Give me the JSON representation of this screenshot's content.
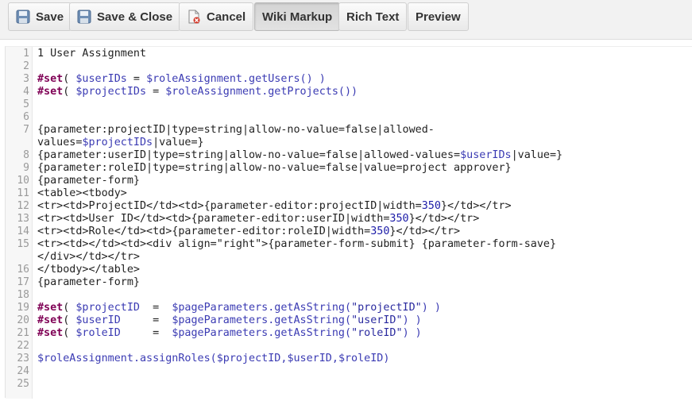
{
  "toolbar": {
    "save_label": "Save",
    "save_close_label": "Save & Close",
    "cancel_label": "Cancel",
    "tabs": [
      {
        "label": "Wiki Markup",
        "active": true
      },
      {
        "label": "Rich Text",
        "active": false
      },
      {
        "label": "Preview",
        "active": false
      }
    ],
    "icons": {
      "save": "floppy-disk-icon",
      "save_close": "floppy-disk-icon",
      "cancel": "document-delete-icon"
    }
  },
  "editor": {
    "line_numbers": [
      "1",
      "2",
      "3",
      "4",
      "5",
      "6",
      "7",
      "8",
      "9",
      "10",
      "11",
      "12",
      "13",
      "14",
      "15",
      "16",
      "17",
      "18",
      "19",
      "20",
      "21",
      "22",
      "23",
      "24",
      "25"
    ],
    "lines": [
      {
        "n": 0,
        "tokens": [
          {
            "t": "1 User Assignment",
            "c": "plain"
          }
        ]
      },
      {
        "n": 2,
        "tokens": [
          {
            "t": "#set",
            "c": "kw"
          },
          {
            "t": "( ",
            "c": "plain"
          },
          {
            "t": "$userIDs",
            "c": "var"
          },
          {
            "t": " = ",
            "c": "plain"
          },
          {
            "t": "$roleAssignment",
            "c": "var"
          },
          {
            "t": ".getUsers() )",
            "c": "var"
          }
        ]
      },
      {
        "n": 3,
        "tokens": [
          {
            "t": "#set",
            "c": "kw"
          },
          {
            "t": "( ",
            "c": "plain"
          },
          {
            "t": "$projectIDs",
            "c": "var"
          },
          {
            "t": " = ",
            "c": "plain"
          },
          {
            "t": "$roleAssignment",
            "c": "var"
          },
          {
            "t": ".getProjects())",
            "c": "var"
          }
        ]
      },
      {
        "n": 6,
        "tokens": [
          {
            "t": "{parameter:projectID|type=string|allow-no-value=false|allowed-",
            "c": "plain"
          }
        ]
      },
      {
        "n": 6,
        "wrap": true,
        "tokens": [
          {
            "t": "values=",
            "c": "plain"
          },
          {
            "t": "$projectIDs",
            "c": "var"
          },
          {
            "t": "|value=}",
            "c": "plain"
          }
        ]
      },
      {
        "n": 7,
        "tokens": [
          {
            "t": "{parameter:userID|type=string|allow-no-value=false|allowed-values=",
            "c": "plain"
          },
          {
            "t": "$userIDs",
            "c": "var"
          },
          {
            "t": "|value=}",
            "c": "plain"
          }
        ]
      },
      {
        "n": 8,
        "tokens": [
          {
            "t": "{parameter:roleID|type=string|allow-no-value=false|value=project approver}",
            "c": "plain"
          }
        ]
      },
      {
        "n": 9,
        "tokens": [
          {
            "t": "{parameter-form}",
            "c": "plain"
          }
        ]
      },
      {
        "n": 10,
        "tokens": [
          {
            "t": "<table><tbody>",
            "c": "plain"
          }
        ]
      },
      {
        "n": 11,
        "tokens": [
          {
            "t": "<tr><td>ProjectID</td><td>{parameter-editor:projectID|width=",
            "c": "plain"
          },
          {
            "t": "350",
            "c": "num"
          },
          {
            "t": "}</td></tr>",
            "c": "plain"
          }
        ]
      },
      {
        "n": 12,
        "tokens": [
          {
            "t": "<tr><td>User ID</td><td>{parameter-editor:userID|width=",
            "c": "plain"
          },
          {
            "t": "350",
            "c": "num"
          },
          {
            "t": "}</td></tr>",
            "c": "plain"
          }
        ]
      },
      {
        "n": 13,
        "tokens": [
          {
            "t": "<tr><td>Role</td><td>{parameter-editor:roleID|width=",
            "c": "plain"
          },
          {
            "t": "350",
            "c": "num"
          },
          {
            "t": "}</td></tr>",
            "c": "plain"
          }
        ]
      },
      {
        "n": 14,
        "tokens": [
          {
            "t": "<tr><td></td><td><div align=\"right\">{parameter-form-submit} {parameter-form-save}",
            "c": "plain"
          }
        ]
      },
      {
        "n": 14,
        "wrap": true,
        "tokens": [
          {
            "t": "</div></td></tr>",
            "c": "plain"
          }
        ]
      },
      {
        "n": 15,
        "tokens": [
          {
            "t": "</tbody></table>",
            "c": "plain"
          }
        ]
      },
      {
        "n": 16,
        "tokens": [
          {
            "t": "{parameter-form}",
            "c": "plain"
          }
        ]
      },
      {
        "n": 18,
        "tokens": [
          {
            "t": "#set",
            "c": "kw"
          },
          {
            "t": "( ",
            "c": "plain"
          },
          {
            "t": "$projectID",
            "c": "var"
          },
          {
            "t": "  =  ",
            "c": "plain"
          },
          {
            "t": "$pageParameters",
            "c": "var"
          },
          {
            "t": ".getAsString(",
            "c": "var"
          },
          {
            "t": "\"projectID\"",
            "c": "str"
          },
          {
            "t": ") )",
            "c": "var"
          }
        ]
      },
      {
        "n": 19,
        "tokens": [
          {
            "t": "#set",
            "c": "kw"
          },
          {
            "t": "( ",
            "c": "plain"
          },
          {
            "t": "$userID",
            "c": "var"
          },
          {
            "t": "     =  ",
            "c": "plain"
          },
          {
            "t": "$pageParameters",
            "c": "var"
          },
          {
            "t": ".getAsString(",
            "c": "var"
          },
          {
            "t": "\"userID\"",
            "c": "str"
          },
          {
            "t": ") )",
            "c": "var"
          }
        ]
      },
      {
        "n": 20,
        "tokens": [
          {
            "t": "#set",
            "c": "kw"
          },
          {
            "t": "( ",
            "c": "plain"
          },
          {
            "t": "$roleID",
            "c": "var"
          },
          {
            "t": "     =  ",
            "c": "plain"
          },
          {
            "t": "$pageParameters",
            "c": "var"
          },
          {
            "t": ".getAsString(",
            "c": "var"
          },
          {
            "t": "\"roleID\"",
            "c": "str"
          },
          {
            "t": ") )",
            "c": "var"
          }
        ]
      },
      {
        "n": 22,
        "tokens": [
          {
            "t": "$roleAssignment",
            "c": "var"
          },
          {
            "t": ".assignRoles(",
            "c": "var"
          },
          {
            "t": "$projectID",
            "c": "var"
          },
          {
            "t": ",",
            "c": "var"
          },
          {
            "t": "$userID",
            "c": "var"
          },
          {
            "t": ",",
            "c": "var"
          },
          {
            "t": "$roleID",
            "c": "var"
          },
          {
            "t": ")",
            "c": "var"
          }
        ]
      }
    ]
  }
}
